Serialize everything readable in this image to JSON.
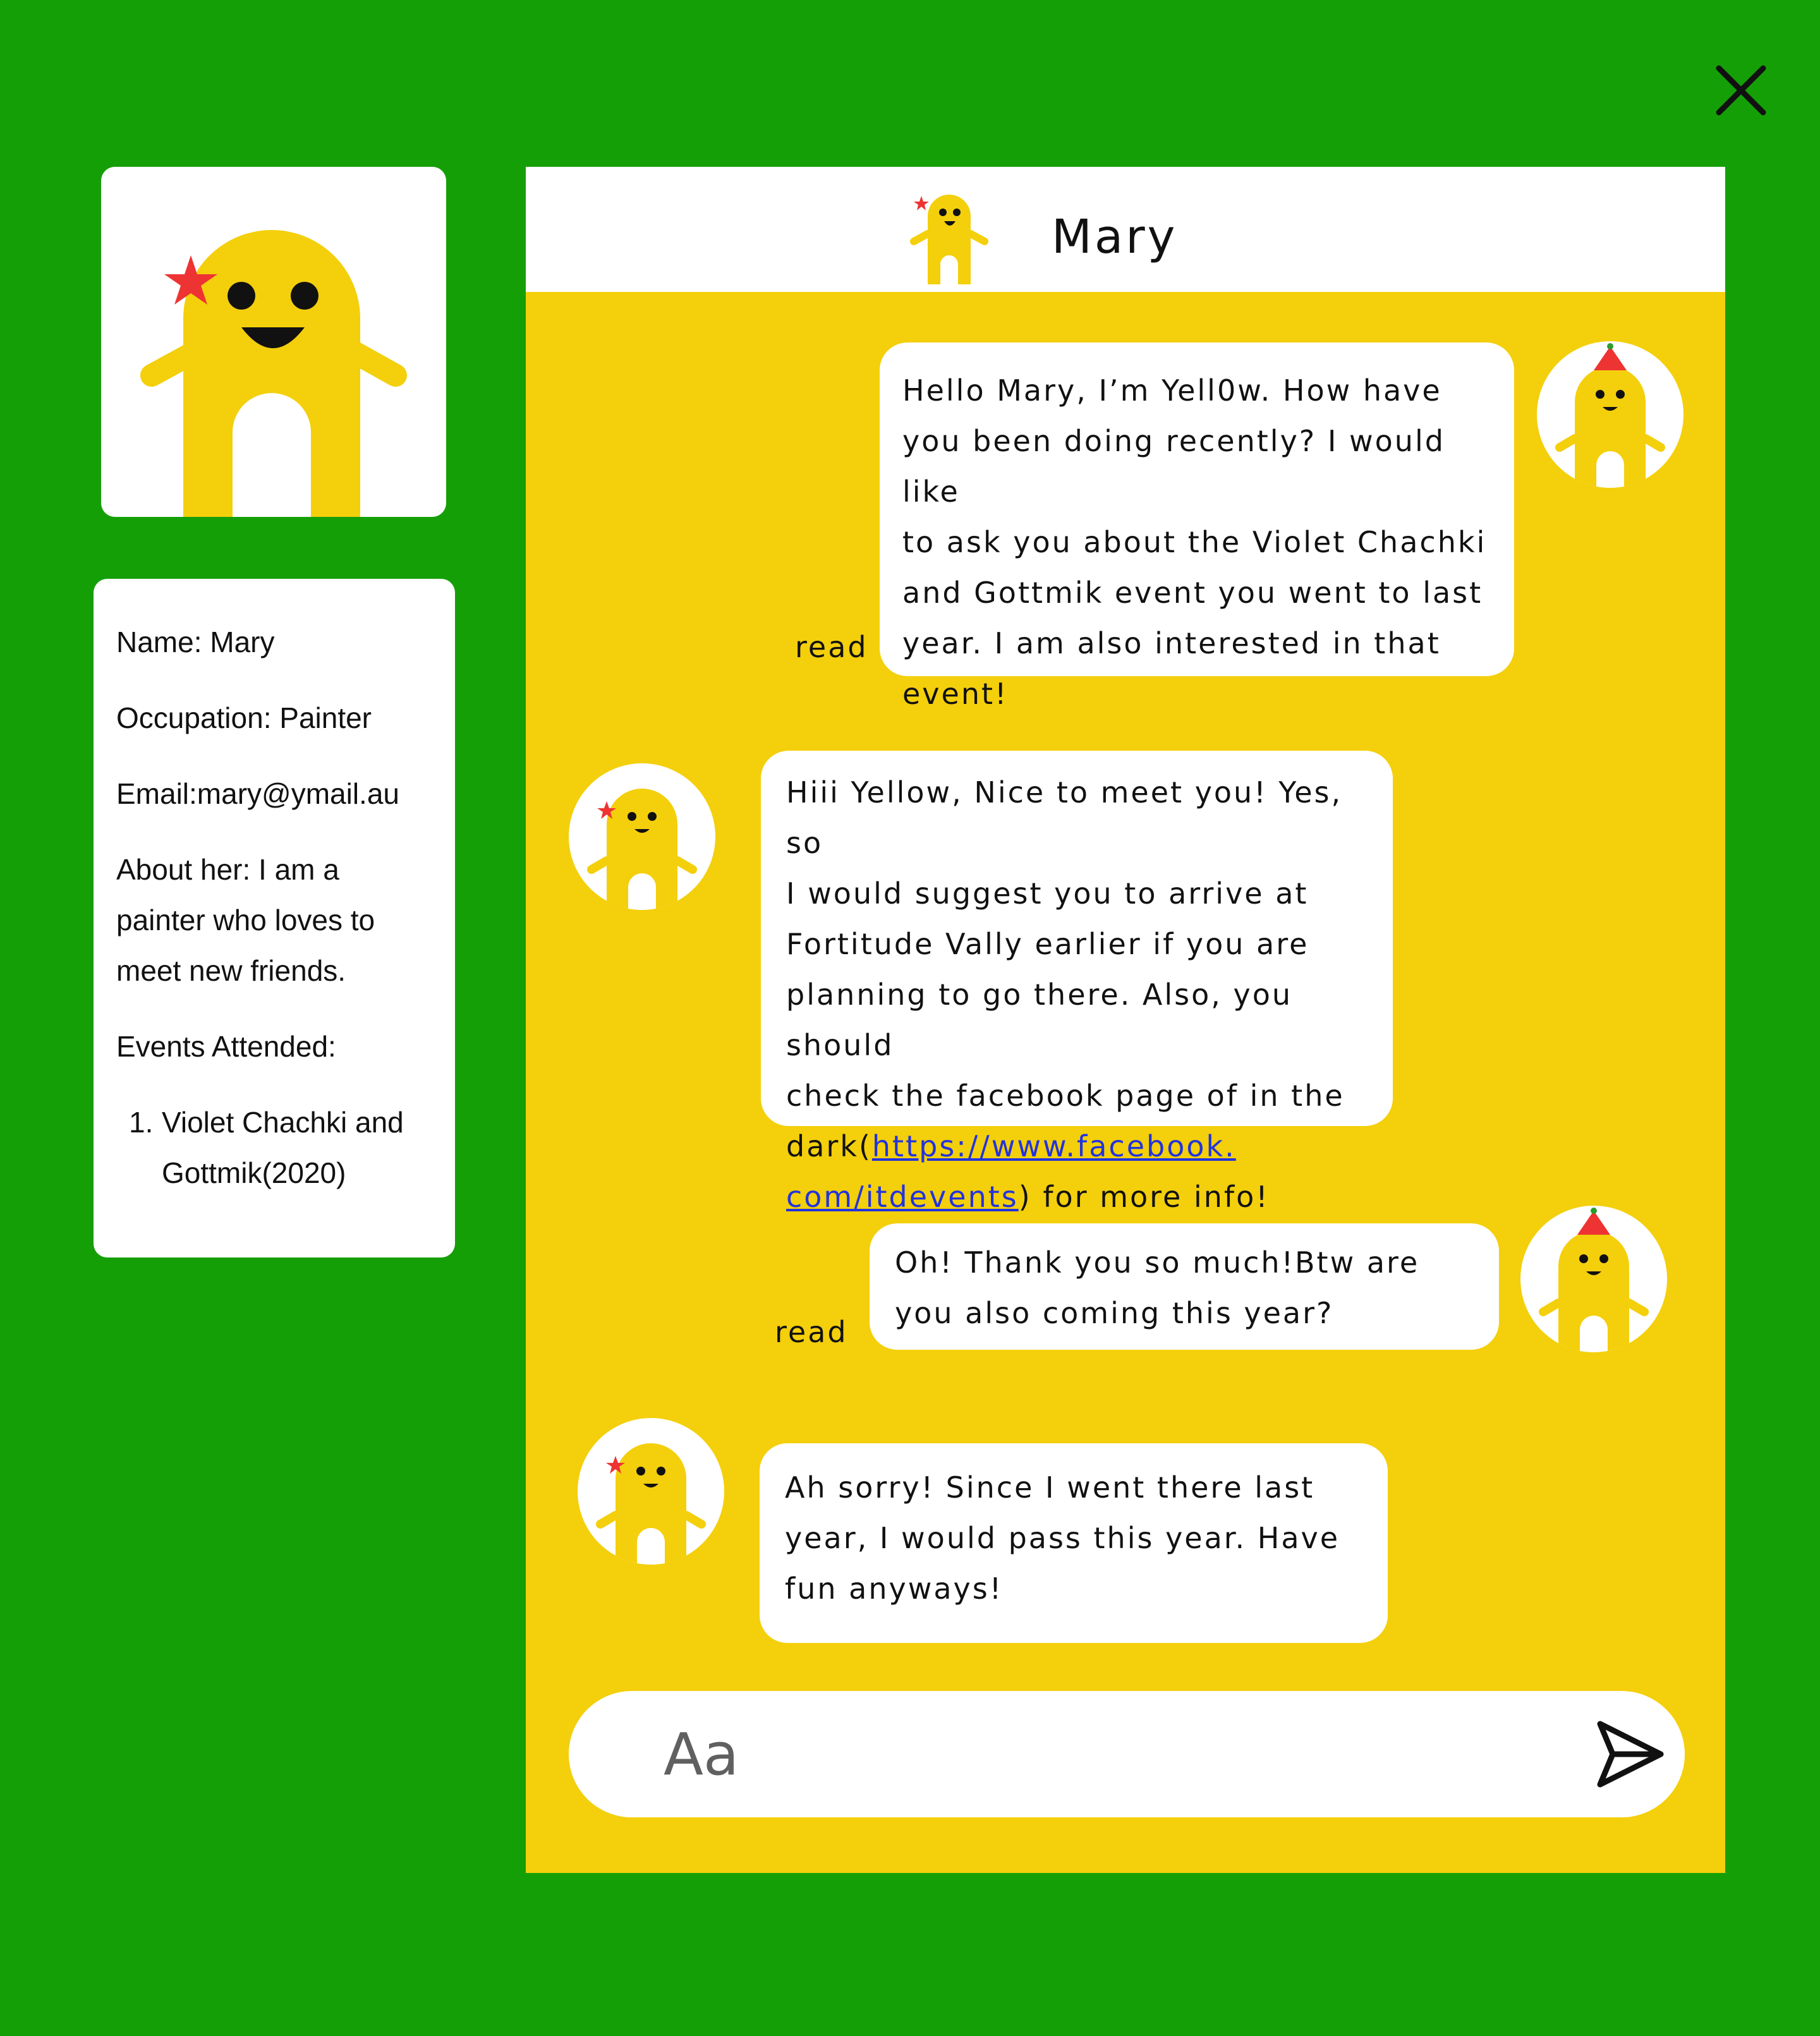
{
  "close_label": "close",
  "profile": {
    "name_line": "Name: Mary",
    "occupation_line": "Occupation: Painter",
    "email_line": "Email:mary@ymail.au",
    "about_lines": [
      "About her: I am a",
      "painter who loves to",
      "meet new friends."
    ],
    "events_heading": "Events Attended:",
    "events": [
      {
        "num": "1.",
        "lines": [
          "Violet Chachki and",
          "Gottmik(2020)"
        ]
      }
    ]
  },
  "chat": {
    "contact_name": "Mary",
    "messages": [
      {
        "sender": "me",
        "status": "read",
        "lines": [
          "Hello Mary, I’m Yell0w. How have",
          "you been doing recently? I would like",
          "to ask you about the Violet Chachki",
          "and Gottmik event you went to last",
          "year. I am also interested in that",
          "event!"
        ]
      },
      {
        "sender": "Mary",
        "lines": [
          "Hiii Yellow, Nice to meet you! Yes, so",
          "I would suggest you to arrive at",
          "Fortitude Vally earlier if you are",
          "planning to go there. Also, you should",
          "check the facebook page of in the"
        ],
        "link_prefix": "dark(",
        "link_line1": "https://www.facebook.",
        "link_line2": "com/itdevents",
        "link_suffix": ") for more info!"
      },
      {
        "sender": "me",
        "status": "read",
        "lines": [
          "Oh! Thank you so much!Btw are",
          "you also coming this year?"
        ]
      },
      {
        "sender": "Mary",
        "lines": [
          "Ah sorry! Since I went there last",
          "year, I would pass this year. Have",
          "fun anyways!"
        ]
      }
    ],
    "input": {
      "placeholder": "Aa",
      "value": ""
    }
  },
  "icons": {
    "close": "close-icon",
    "send": "send-icon",
    "avatar_mary": "yellow-character-with-red-star",
    "avatar_me": "yellow-character-with-party-hat"
  },
  "colors": {
    "background": "#159f07",
    "chat_background": "#f4cf0b",
    "character": "#f4cf0b",
    "star": "#ee3333",
    "hat": "#ee3333",
    "link": "#2233dd"
  }
}
